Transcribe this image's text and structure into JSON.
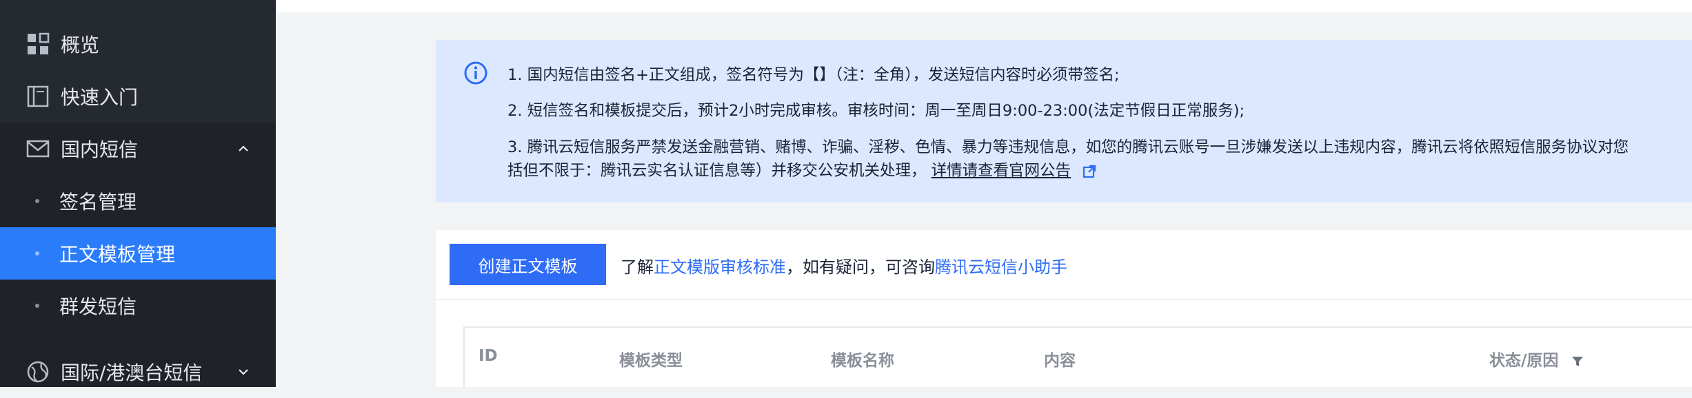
{
  "sidebar": {
    "items": [
      {
        "label": "概览",
        "icon": "grid-icon"
      },
      {
        "label": "快速入门",
        "icon": "book-icon"
      },
      {
        "label": "国内短信",
        "icon": "mail-icon",
        "expanded": true,
        "children": [
          {
            "label": "签名管理",
            "active": false
          },
          {
            "label": "正文模板管理",
            "active": true
          },
          {
            "label": "群发短信",
            "active": false
          }
        ]
      },
      {
        "label": "国际/港澳台短信",
        "icon": "globe-icon",
        "expanded": false
      }
    ]
  },
  "notice": {
    "icon": "info-icon",
    "lines": [
      "1. 国内短信由签名+正文组成，签名符号为【】（注：全角），发送短信内容时必须带签名;",
      "2. 短信签名和模板提交后，预计2小时完成审核。审核时间：周一至周日9:00-23:00(法定节假日正常服务);",
      "3. 腾讯云短信服务严禁发送金融营销、赌博、诈骗、淫秽、色情、暴力等违规信息，如您的腾讯云账号一旦涉嫌发送以上违规内容，腾讯云将依照短信服务协议对您",
      "括但不限于：腾讯云实名认证信息等）并移交公安机关处理，"
    ],
    "link_label": "详情请查看官网公告"
  },
  "toolbar": {
    "create_label": "创建正文模板",
    "tip_prefix": "了解",
    "tip_link1": "正文模版审核标准",
    "tip_mid": "，如有疑问，可咨询",
    "tip_link2": "腾讯云短信小助手"
  },
  "table": {
    "columns": [
      "ID",
      "模板类型",
      "模板名称",
      "内容",
      "状态/原因"
    ]
  },
  "colors": {
    "sidebar_bg": "#1f2329",
    "active_bg": "#2b7cfb",
    "notice_bg": "#dbe8ff",
    "primary": "#2e6cf6"
  }
}
